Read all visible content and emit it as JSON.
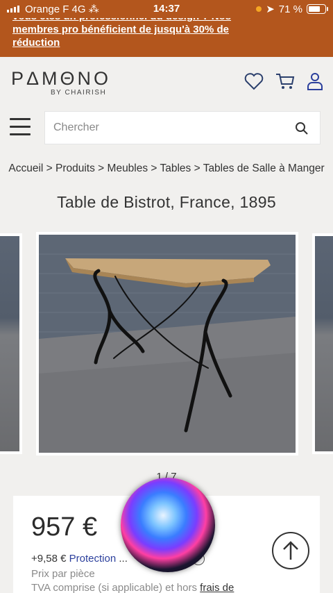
{
  "status_bar": {
    "carrier": "Orange F",
    "network": "4G",
    "time": "14:37",
    "battery": "71 %",
    "battery_level": 0.71
  },
  "promo": {
    "line1": "vous êtes un professionnel du design ? Nos",
    "line2": "membres pro bénéficient de jusqu'à 30% de",
    "line3": "réduction"
  },
  "header": {
    "logo": "PΔMΘNO",
    "byline": "BY CHAIRISH",
    "icons": [
      "heart-icon",
      "cart-icon",
      "user-icon"
    ]
  },
  "search": {
    "placeholder": "Chercher"
  },
  "breadcrumb": "Accueil > Produits > Meubles > Tables > Tables de Salle à Manger",
  "product": {
    "title": "Table de Bistrot, France, 1895",
    "counter": "1 / 7",
    "price": "957 €",
    "shipping_prefix": "+9,58 €",
    "shipping_link": "Protection",
    "shipping_rest": "...",
    "per_piece": "Prix par pièce",
    "vat_text": "TVA comprise (si applicable) et hors",
    "vat_link": "frais de"
  },
  "colors": {
    "accent": "#b3561d",
    "link": "#2b3f9c",
    "background": "#f1f0ee"
  }
}
